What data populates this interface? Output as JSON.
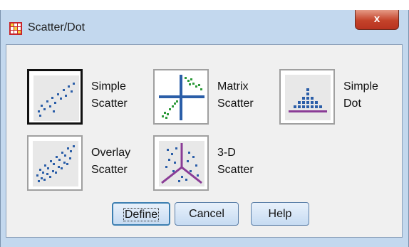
{
  "window": {
    "title": "Scatter/Dot",
    "close_label": "x"
  },
  "options": [
    {
      "line1": "Simple",
      "line2": "Scatter",
      "selected": true,
      "icon": "simple-scatter-icon"
    },
    {
      "line1": "Matrix",
      "line2": "Scatter",
      "selected": false,
      "icon": "matrix-scatter-icon"
    },
    {
      "line1": "Simple",
      "line2": "Dot",
      "selected": false,
      "icon": "simple-dot-icon"
    },
    {
      "line1": "Overlay",
      "line2": "Scatter",
      "selected": false,
      "icon": "overlay-scatter-icon"
    },
    {
      "line1": "3-D",
      "line2": "Scatter",
      "selected": false,
      "icon": "3d-scatter-icon"
    }
  ],
  "buttons": {
    "define": "Define",
    "cancel": "Cancel",
    "help": "Help"
  },
  "colors": {
    "icon_blue": "#2b5ea8",
    "icon_green": "#2e9a3a",
    "icon_purple": "#8a3c96",
    "close_red": "#c4432a"
  }
}
